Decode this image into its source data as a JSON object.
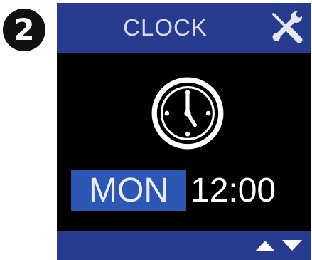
{
  "step_badge": {
    "label": "2"
  },
  "screen": {
    "title": "CLOCK",
    "settings_icon": "wrench-screwdriver-icon",
    "clock_icon": "clock-icon",
    "day": "MON",
    "time": "12:00",
    "footer": {
      "up_icon": "arrow-up-icon",
      "down_icon": "arrow-down-icon"
    }
  },
  "colors": {
    "header_bg": "#283c8f",
    "day_highlight": "#2e57b4",
    "screen_bg": "#000000",
    "text": "#ffffff"
  }
}
